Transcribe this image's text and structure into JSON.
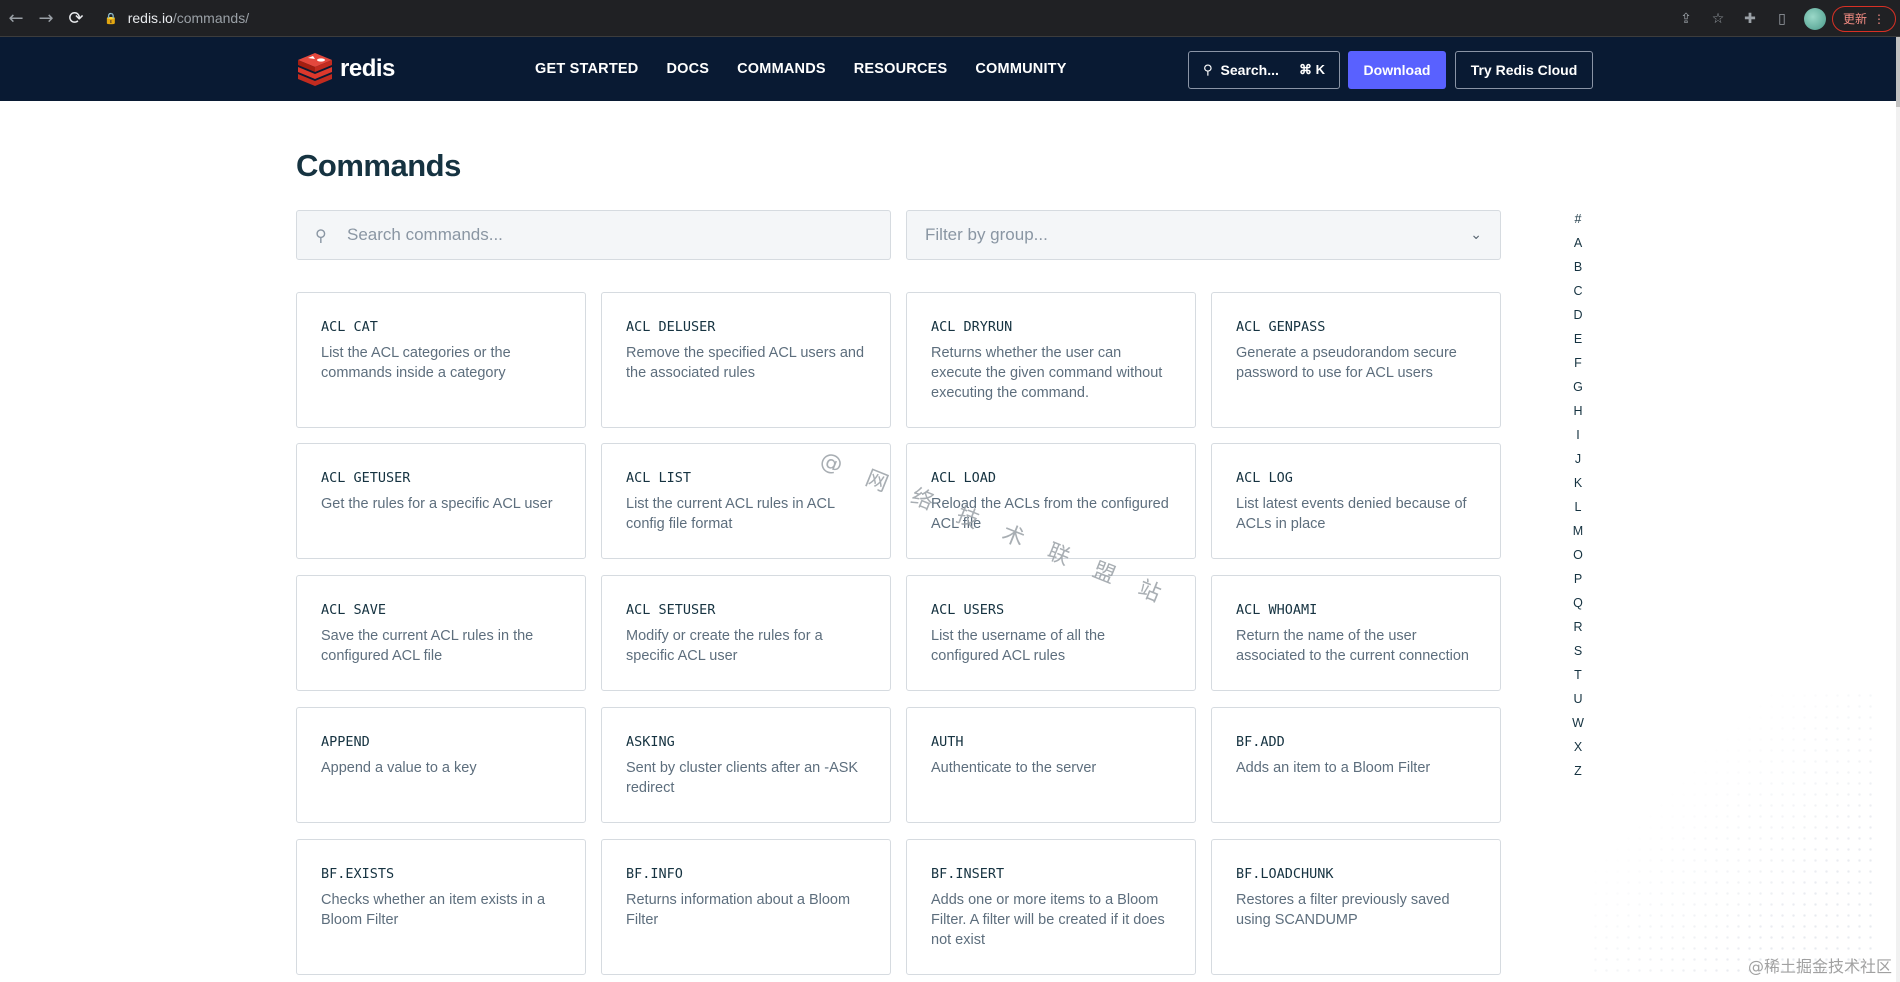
{
  "browser": {
    "back_icon": "←",
    "forward_icon": "→",
    "reload_icon": "⟳",
    "lock_icon": "🔒",
    "url_host": "redis.io",
    "url_path": "/commands/",
    "update_label": "更新"
  },
  "header": {
    "logo_text": "redis",
    "nav": [
      "GET STARTED",
      "DOCS",
      "COMMANDS",
      "RESOURCES",
      "COMMUNITY"
    ],
    "search_label": "Search...",
    "search_shortcut": "⌘ K",
    "download_label": "Download",
    "cloud_label": "Try Redis Cloud",
    "colors": {
      "header_bg": "#091a33",
      "accent": "#5961ff",
      "logo_red": "#dc382c"
    }
  },
  "main": {
    "title": "Commands",
    "search_placeholder": "Search commands...",
    "filter_placeholder": "Filter by group..."
  },
  "commands": [
    {
      "name": "ACL CAT",
      "desc": "List the ACL categories or the commands inside a category"
    },
    {
      "name": "ACL DELUSER",
      "desc": "Remove the specified ACL users and the associated rules"
    },
    {
      "name": "ACL DRYRUN",
      "desc": "Returns whether the user can execute the given command without executing the command."
    },
    {
      "name": "ACL GENPASS",
      "desc": "Generate a pseudorandom secure password to use for ACL users"
    },
    {
      "name": "ACL GETUSER",
      "desc": "Get the rules for a specific ACL user"
    },
    {
      "name": "ACL LIST",
      "desc": "List the current ACL rules in ACL config file format"
    },
    {
      "name": "ACL LOAD",
      "desc": "Reload the ACLs from the configured ACL file"
    },
    {
      "name": "ACL LOG",
      "desc": "List latest events denied because of ACLs in place"
    },
    {
      "name": "ACL SAVE",
      "desc": "Save the current ACL rules in the configured ACL file"
    },
    {
      "name": "ACL SETUSER",
      "desc": "Modify or create the rules for a specific ACL user"
    },
    {
      "name": "ACL USERS",
      "desc": "List the username of all the configured ACL rules"
    },
    {
      "name": "ACL WHOAMI",
      "desc": "Return the name of the user associated to the current connection"
    },
    {
      "name": "APPEND",
      "desc": "Append a value to a key"
    },
    {
      "name": "ASKING",
      "desc": "Sent by cluster clients after an -ASK redirect"
    },
    {
      "name": "AUTH",
      "desc": "Authenticate to the server"
    },
    {
      "name": "BF.ADD",
      "desc": "Adds an item to a Bloom Filter"
    },
    {
      "name": "BF.EXISTS",
      "desc": "Checks whether an item exists in a Bloom Filter"
    },
    {
      "name": "BF.INFO",
      "desc": "Returns information about a Bloom Filter"
    },
    {
      "name": "BF.INSERT",
      "desc": "Adds one or more items to a Bloom Filter. A filter will be created if it does not exist"
    },
    {
      "name": "BF.LOADCHUNK",
      "desc": "Restores a filter previously saved using SCANDUMP"
    }
  ],
  "alphabet": [
    "#",
    "A",
    "B",
    "C",
    "D",
    "E",
    "F",
    "G",
    "H",
    "I",
    "J",
    "K",
    "L",
    "M",
    "O",
    "P",
    "Q",
    "R",
    "S",
    "T",
    "U",
    "W",
    "X",
    "Z"
  ],
  "watermark": "@ 网 络 技 术 联 盟 站",
  "corner_watermark": "@稀土掘金技术社区"
}
